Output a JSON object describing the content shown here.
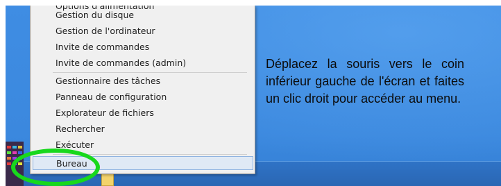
{
  "context_menu": {
    "partial_top_item": "Options d'alimentation",
    "items_group1": [
      "Gestion du disque",
      "Gestion de l'ordinateur",
      "Invite de commandes",
      "Invite de commandes (admin)"
    ],
    "items_group2": [
      "Gestionnaire des tâches",
      "Panneau de configuration",
      "Explorateur de fichiers",
      "Rechercher",
      "Exécuter"
    ],
    "highlighted_item": "Bureau"
  },
  "instruction_text": "Déplacez la souris vers le coin inférieur gauche de l'écran et faites un clic droit pour accéder au menu.",
  "colors": {
    "highlight_ring": "#18d81c",
    "desktop_blue": "#3b88de",
    "menu_background": "#f0f0f0"
  }
}
